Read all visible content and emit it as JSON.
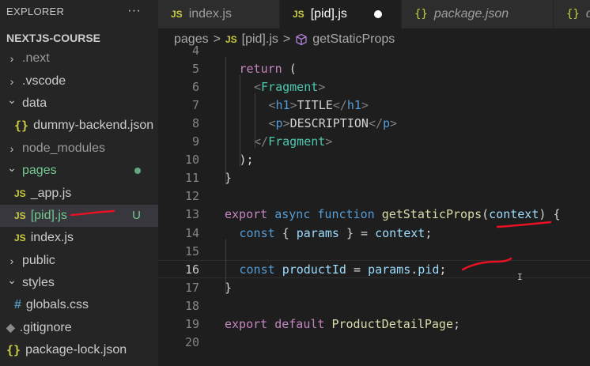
{
  "explorer": {
    "title": "EXPLORER",
    "more_label": "···",
    "section": "NEXTJS-COURSE",
    "items": [
      {
        "label": ".next",
        "chevron": "›",
        "icon": "",
        "status": "",
        "dim": true
      },
      {
        "label": ".vscode",
        "chevron": "›",
        "icon": "",
        "status": "",
        "dim": false
      },
      {
        "label": "data",
        "chevron": "⌄",
        "icon": "",
        "status": "",
        "dim": false
      },
      {
        "label": "dummy-backend.json",
        "chevron": "",
        "icon": "{}",
        "status": "",
        "dim": false
      },
      {
        "label": "node_modules",
        "chevron": "›",
        "icon": "",
        "status": "",
        "dim": true
      },
      {
        "label": "pages",
        "chevron": "⌄",
        "icon": "",
        "status": "●",
        "dim": false
      },
      {
        "label": "_app.js",
        "chevron": "",
        "icon": "JS",
        "status": "",
        "dim": false
      },
      {
        "label": "[pid].js",
        "chevron": "",
        "icon": "JS",
        "status": "U",
        "dim": false
      },
      {
        "label": "index.js",
        "chevron": "",
        "icon": "JS",
        "status": "",
        "dim": false
      },
      {
        "label": "public",
        "chevron": "›",
        "icon": "",
        "status": "",
        "dim": false
      },
      {
        "label": "styles",
        "chevron": "⌄",
        "icon": "",
        "status": "",
        "dim": false
      },
      {
        "label": "globals.css",
        "chevron": "",
        "icon": "#",
        "status": "",
        "dim": false
      },
      {
        "label": ".gitignore",
        "chevron": "",
        "icon": "◆",
        "status": "",
        "dim": false
      },
      {
        "label": "package-lock.json",
        "chevron": "",
        "icon": "{}",
        "status": "",
        "dim": false
      }
    ]
  },
  "tabs": [
    {
      "icon": "JS",
      "label": "index.js",
      "active": false,
      "dirty": false,
      "italic": false
    },
    {
      "icon": "JS",
      "label": "[pid].js",
      "active": true,
      "dirty": true,
      "italic": false
    },
    {
      "icon": "{}",
      "label": "package.json",
      "active": false,
      "dirty": false,
      "italic": true
    },
    {
      "icon": "{}",
      "label": "dum",
      "active": false,
      "dirty": false,
      "italic": true
    }
  ],
  "breadcrumb": {
    "folder": "pages",
    "file_icon": "JS",
    "file": "[pid].js",
    "symbol_icon": "cube-icon",
    "symbol": "getStaticProps",
    "separator": ">"
  },
  "editor": {
    "current_line": 16,
    "lines": [
      {
        "num": "4",
        "text": ""
      },
      {
        "num": "5",
        "text": "return ("
      },
      {
        "num": "6",
        "text": "<Fragment>"
      },
      {
        "num": "7",
        "text": "<h1>TITLE</h1>"
      },
      {
        "num": "8",
        "text": "<p>DESCRIPTION</p>"
      },
      {
        "num": "9",
        "text": "</Fragment>"
      },
      {
        "num": "10",
        "text": ");"
      },
      {
        "num": "11",
        "text": "}"
      },
      {
        "num": "12",
        "text": ""
      },
      {
        "num": "13",
        "text": "export async function getStaticProps(context) {"
      },
      {
        "num": "14",
        "text": "const { params } = context;"
      },
      {
        "num": "15",
        "text": ""
      },
      {
        "num": "16",
        "text": "const productId = params.pid;"
      },
      {
        "num": "17",
        "text": "}"
      },
      {
        "num": "18",
        "text": ""
      },
      {
        "num": "19",
        "text": "export default ProductDetailPage;"
      },
      {
        "num": "20",
        "text": ""
      }
    ]
  },
  "colors": {
    "annotation": "#e81123",
    "untracked": "#73c991",
    "js_icon": "#cbcb41"
  }
}
